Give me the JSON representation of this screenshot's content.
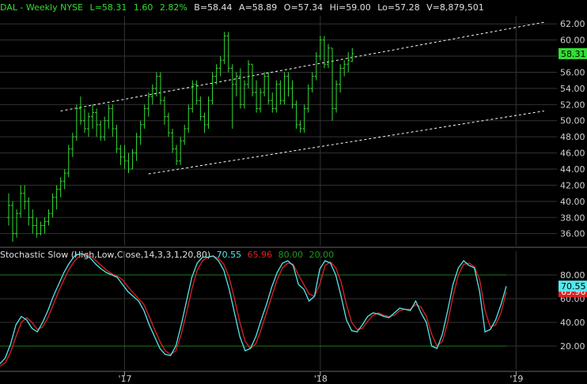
{
  "header": {
    "symbol": "DAL - Weekly NYSE",
    "last": "L=58.31",
    "change": "1.60",
    "change_pct": "2.82%",
    "bid": "B=58.44",
    "ask": "A=58.89",
    "open": "O=57.34",
    "high": "Hi=59.00",
    "low": "Lo=57.28",
    "volume": "V=8,879,501"
  },
  "indicator": {
    "name": "Stochastic Slow (High,Low,Close,14,3,3,1,20,80)",
    "k_value": "70.55",
    "d_value": "65.96",
    "upper_level": "80.00",
    "lower_level": "20.00"
  },
  "colors": {
    "background": "#000000",
    "up_bar": "#33dd33",
    "k_line": "#55e8ee",
    "d_line": "#dd2222",
    "level_line": "#1c7a1c",
    "grid": "#333333",
    "channel": "#ffffff"
  },
  "chart_data": [
    {
      "type": "ohlc",
      "interval": "weekly",
      "y_ticks": [
        36,
        38,
        40,
        42,
        44,
        46,
        48,
        50,
        52,
        54,
        56,
        58,
        60,
        62
      ],
      "y_tick_labels": [
        "36.00",
        "38.00",
        "40.00",
        "42.00",
        "44.00",
        "46.00",
        "48.00",
        "50.00",
        "52.00",
        "54.00",
        "56.00",
        "58.00",
        "60.00",
        "62.00"
      ],
      "ylim": [
        34.5,
        63
      ],
      "x_ticks": [
        {
          "label": "'17",
          "i": 29
        },
        {
          "label": "'18",
          "i": 78
        },
        {
          "label": "'19",
          "i": 127
        }
      ],
      "last_price_tag": "58.31",
      "channel_lines": [
        {
          "from": [
            13,
            51.2
          ],
          "to": [
            134,
            62.2
          ]
        },
        {
          "from": [
            35,
            43.4
          ],
          "to": [
            134,
            51.2
          ]
        }
      ],
      "series": [
        {
          "values": [
            [
              38,
              41,
              37,
              39.5
            ],
            [
              39.5,
              40,
              35,
              36
            ],
            [
              36,
              39,
              35.5,
              38.5
            ],
            [
              38.5,
              42,
              38,
              41
            ],
            [
              41,
              42,
              39,
              40
            ],
            [
              40,
              40.5,
              37,
              38
            ],
            [
              38,
              39,
              36,
              37
            ],
            [
              37,
              38,
              35.5,
              36
            ],
            [
              36,
              37.5,
              35.8,
              37
            ],
            [
              37,
              38,
              36,
              37.5
            ],
            [
              37.5,
              39,
              37,
              38.5
            ],
            [
              38.5,
              41,
              38,
              40.5
            ],
            [
              40.5,
              42,
              39,
              41.5
            ],
            [
              41.5,
              43,
              40.5,
              42.5
            ],
            [
              42.5,
              44,
              41.5,
              43.5
            ],
            [
              43.5,
              47,
              43,
              46.5
            ],
            [
              46.5,
              48.5,
              45.5,
              48
            ],
            [
              48,
              52,
              47.5,
              51.5
            ],
            [
              51.5,
              53,
              49.5,
              50
            ],
            [
              50,
              51.5,
              48.5,
              49
            ],
            [
              49,
              51,
              48,
              50.5
            ],
            [
              50.5,
              52,
              49,
              51
            ],
            [
              51,
              51.5,
              48,
              49.5
            ],
            [
              49.5,
              50,
              47.5,
              48
            ],
            [
              48,
              50.5,
              47.5,
              50
            ],
            [
              50,
              52,
              49,
              51.5
            ],
            [
              51.5,
              52,
              48,
              49
            ],
            [
              49,
              49.5,
              46,
              46.5
            ],
            [
              46.5,
              47,
              44.5,
              45.5
            ],
            [
              45.5,
              47,
              44,
              45
            ],
            [
              45,
              46,
              43.5,
              44
            ],
            [
              44,
              46.5,
              44,
              46
            ],
            [
              46,
              48.5,
              45,
              48
            ],
            [
              48,
              50,
              47,
              49.5
            ],
            [
              49.5,
              52,
              49,
              51.5
            ],
            [
              51.5,
              53.5,
              50.5,
              53
            ],
            [
              53,
              54.5,
              52,
              54
            ],
            [
              54,
              56,
              53,
              55.5
            ],
            [
              55.5,
              56,
              52,
              52.5
            ],
            [
              52.5,
              53,
              49.5,
              50.5
            ],
            [
              50.5,
              51,
              48,
              48.5
            ],
            [
              48.5,
              49,
              46,
              46.5
            ],
            [
              46.5,
              47,
              44.5,
              45
            ],
            [
              45,
              48,
              44.5,
              47.5
            ],
            [
              47.5,
              49.5,
              47,
              49
            ],
            [
              49,
              52,
              48.5,
              51.5
            ],
            [
              51.5,
              55,
              51,
              54.5
            ],
            [
              54.5,
              55,
              52,
              52.5
            ],
            [
              52.5,
              53,
              50,
              50.5
            ],
            [
              50.5,
              51,
              48.5,
              49.5
            ],
            [
              49.5,
              53,
              49,
              52.5
            ],
            [
              52.5,
              56,
              52,
              55.5
            ],
            [
              55.5,
              57,
              54.5,
              56.5
            ],
            [
              56.5,
              58,
              55.5,
              57.5
            ],
            [
              57.5,
              61,
              57,
              60.5
            ],
            [
              60.5,
              61,
              56,
              56.5
            ],
            [
              56.5,
              57,
              49,
              54.5
            ],
            [
              54.5,
              56,
              53,
              55.5
            ],
            [
              55.5,
              56.5,
              51.5,
              52
            ],
            [
              52,
              55,
              51.5,
              54.5
            ],
            [
              54.5,
              57.5,
              54,
              57
            ],
            [
              57,
              57,
              53,
              53.5
            ],
            [
              53.5,
              55,
              51,
              51.5
            ],
            [
              51.5,
              54,
              51,
              53.5
            ],
            [
              53.5,
              56,
              53,
              55.5
            ],
            [
              55.5,
              56,
              52,
              52.5
            ],
            [
              52.5,
              53.5,
              51,
              51.5
            ],
            [
              51.5,
              55,
              51,
              54.5
            ],
            [
              54.5,
              55,
              52,
              52.5
            ],
            [
              52.5,
              56,
              52,
              55.5
            ],
            [
              55.5,
              56,
              53,
              54
            ],
            [
              54,
              55,
              51.5,
              52
            ],
            [
              52,
              52.5,
              49,
              49.5
            ],
            [
              49.5,
              50,
              48.5,
              49
            ],
            [
              49,
              52,
              48.5,
              51.5
            ],
            [
              51.5,
              54.5,
              51,
              54
            ],
            [
              54,
              56,
              53.5,
              55.5
            ],
            [
              55.5,
              58.5,
              55,
              58
            ],
            [
              58,
              60.5,
              57.5,
              60
            ],
            [
              60,
              60.5,
              56.5,
              57
            ],
            [
              57,
              59.5,
              56.5,
              59
            ],
            [
              59,
              59,
              50,
              51.5
            ],
            [
              51.5,
              55,
              51,
              54.5
            ],
            [
              54.5,
              57,
              53.5,
              56.5
            ],
            [
              56.5,
              57.5,
              55.5,
              57
            ],
            [
              57,
              58.5,
              56,
              57.5
            ],
            [
              57.34,
              59,
              57.28,
              58.31
            ]
          ]
        }
      ]
    },
    {
      "type": "line",
      "title": "Stochastic Slow (High,Low,Close,14,3,3,1,20,80)",
      "y_ticks": [
        20,
        40,
        60,
        80
      ],
      "y_tick_labels": [
        "20.00",
        "40.00",
        "60.00",
        "80.00"
      ],
      "ylim": [
        0,
        100
      ],
      "levels": [
        80,
        20
      ],
      "tags": {
        "k": "70.55",
        "d": "65.96"
      },
      "series": [
        {
          "name": "%K",
          "values": [
            5,
            10,
            22,
            38,
            45,
            42,
            35,
            32,
            40,
            50,
            62,
            72,
            82,
            90,
            96,
            98,
            97,
            94,
            89,
            85,
            82,
            80,
            78,
            72,
            66,
            62,
            58,
            50,
            38,
            28,
            18,
            13,
            12,
            20,
            38,
            58,
            78,
            90,
            95,
            95,
            96,
            92,
            84,
            68,
            48,
            28,
            16,
            18,
            28,
            42,
            55,
            70,
            82,
            90,
            92,
            88,
            72,
            68,
            58,
            62,
            85,
            92,
            90,
            80,
            62,
            42,
            33,
            32,
            38,
            45,
            48,
            47,
            45,
            44,
            48,
            52,
            51,
            50,
            58,
            48,
            40,
            20,
            18,
            30,
            50,
            72,
            86,
            92,
            88,
            86,
            66,
            32,
            34,
            42,
            55,
            70.55
          ]
        },
        {
          "name": "%D",
          "values": [
            3,
            6,
            15,
            28,
            40,
            44,
            40,
            34,
            36,
            44,
            55,
            66,
            76,
            85,
            92,
            96,
            98,
            96,
            92,
            88,
            84,
            81,
            79,
            76,
            70,
            65,
            60,
            55,
            45,
            34,
            24,
            16,
            13,
            16,
            30,
            48,
            68,
            84,
            92,
            95,
            96,
            94,
            89,
            78,
            60,
            40,
            24,
            18,
            22,
            34,
            48,
            62,
            76,
            86,
            90,
            89,
            80,
            72,
            64,
            62,
            72,
            88,
            91,
            86,
            74,
            55,
            40,
            34,
            35,
            41,
            46,
            48,
            46,
            45,
            46,
            50,
            51,
            51,
            55,
            53,
            45,
            30,
            20,
            24,
            40,
            62,
            80,
            89,
            90,
            87,
            76,
            50,
            36,
            38,
            48,
            65.96
          ]
        }
      ]
    }
  ]
}
